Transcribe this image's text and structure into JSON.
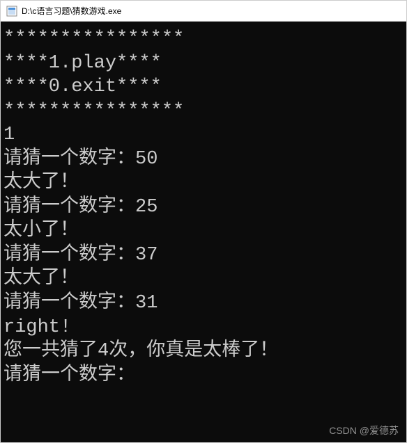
{
  "window": {
    "title": "D:\\c语言习题\\猜数游戏.exe"
  },
  "console": {
    "lines": [
      "",
      "****************",
      "****1.play****",
      "****0.exit****",
      "****************",
      "1",
      "请猜一个数字：50",
      "太大了！",
      "请猜一个数字：25",
      "太小了！",
      "请猜一个数字：37",
      "太大了！",
      "请猜一个数字：31",
      "right!",
      "您一共猜了4次，你真是太棒了！",
      "请猜一个数字："
    ]
  },
  "watermark": "CSDN @爱德苏"
}
